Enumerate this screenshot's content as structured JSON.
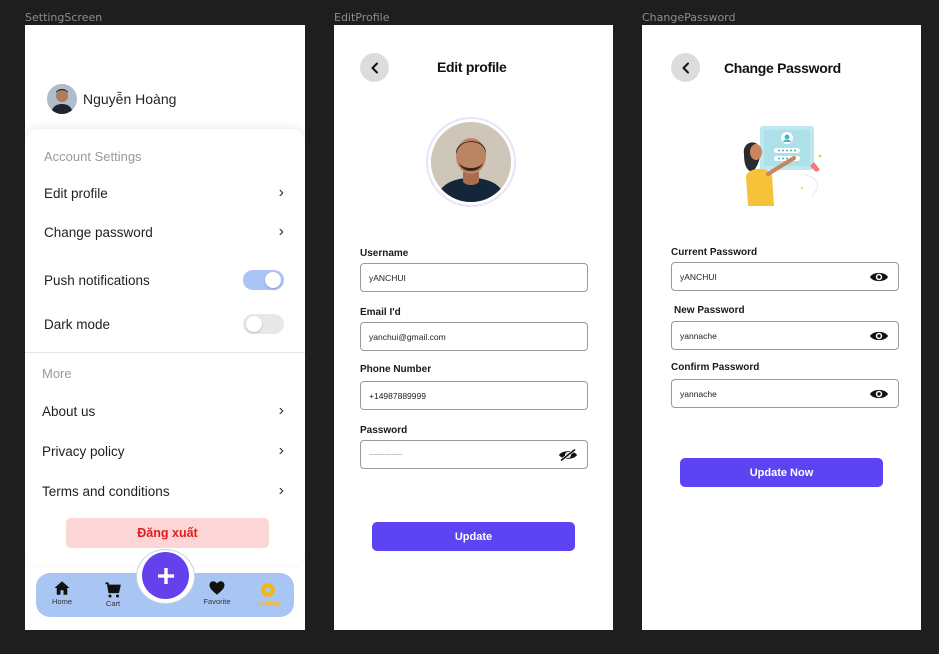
{
  "frames": {
    "setting": "SettingScreen",
    "edit": "EditProfile",
    "change": "ChangePassword"
  },
  "setting": {
    "user_name": "Nguyễn Hoàng",
    "account_section": "Account Settings",
    "edit_profile": "Edit profile",
    "change_password": "Change password",
    "push_notifications": "Push notifications",
    "push_notifications_on": true,
    "dark_mode": "Dark mode",
    "dark_mode_on": false,
    "more_section": "More",
    "about_us": "About us",
    "privacy_policy": "Privacy policy",
    "terms": "Terms and conditions",
    "logout": "Đăng xuất",
    "fab_icon": "plus-icon",
    "nav": {
      "home": "Home",
      "cart": "Cart",
      "favorite": "Favorite",
      "setting": "Setting"
    },
    "colors": {
      "accent": "#6441ea",
      "nav_bg": "#a9c5f4",
      "active": "#f3b614",
      "logout_text": "#e01e1e",
      "logout_bg": "#fcd6d6"
    }
  },
  "edit": {
    "title": "Edit profile",
    "username_label": "Username",
    "username_value": "yANCHUI",
    "email_label": "Email I'd",
    "email_value": "yanchui@gmail.com",
    "phone_label": "Phone Number",
    "phone_value": "+14987889999",
    "password_label": "Password",
    "password_value": "······················",
    "password_icon": "eye-slash-icon",
    "update": "Update"
  },
  "change": {
    "title": "Change Password",
    "current_label": "Current Password",
    "current_value": "yANCHUI",
    "new_label": "New Password",
    "new_value": "yannache",
    "confirm_label": "Confirm Password",
    "confirm_value": "yannache",
    "password_icon": "eye-icon",
    "update": "Update Now"
  }
}
